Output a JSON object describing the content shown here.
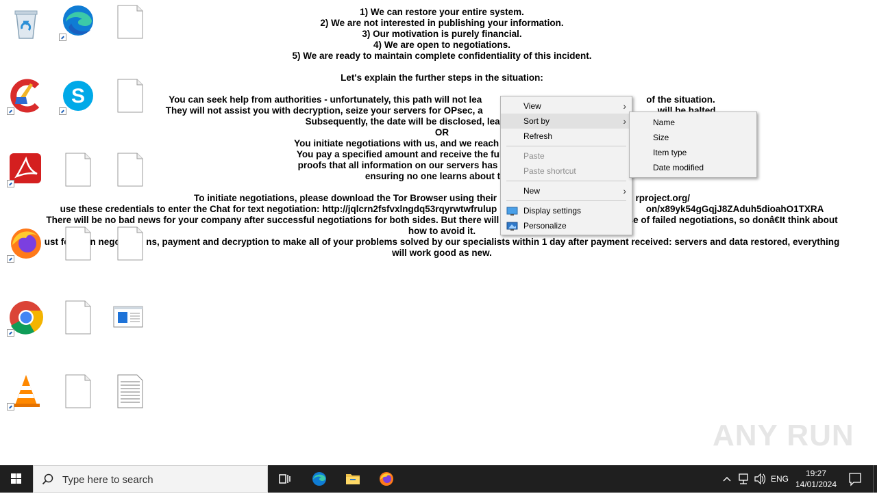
{
  "ransom_note": {
    "lines": [
      "1) We can restore your entire system.",
      "2) We are not interested in publishing your information.",
      "3) Our motivation is purely financial.",
      "4) We are open to negotiations.",
      "5) We are ready to maintain complete confidentiality of this incident.",
      "",
      "Let's explain the further steps in the situation:",
      "",
      "You can seek help from authorities - unfortunately, this path will not lea                                                                of the situation.",
      "They will not assist you with decryption, seize your servers for OPsec, a                                                                    will be halted.",
      "Subsequently, the date will be disclosed, leading to fines, lega",
      "OR",
      "You initiate negotiations with us, and we reach a mutually beneficia",
      "You pay a specified amount and receive the full decryption, suppo",
      "proofs that all information on our servers has been deleted, and a",
      "ensuring no one learns about this i",
      "",
      "To initiate negotiations, please download the Tor Browser using their                                                      rproject.org/",
      "use these credentials to enter the Chat for text negotiation: http://jqlcrn2fsfvxlngdq53rqyrwtwfrulup                                                          on/x89yk54gGqjJ8ZAduh5dioahO1TXRA",
      "There will be no bad news for your company after successful negotiations for both sides. But there will be                                             se of failed negotiations, so donâ€It think about",
      "how to avoid it.",
      "ust fo        n nego          ns, payment and decryption to make all of your problems solved by our specialists within 1 day after payment received: servers and data restored, everything",
      "will work good as new."
    ]
  },
  "desktop_icons": [
    {
      "name": "recycle-bin-icon",
      "shortcut": false
    },
    {
      "name": "edge-icon",
      "shortcut": true
    },
    {
      "name": "blank-file-icon",
      "shortcut": false
    },
    {
      "name": "ccleaner-icon",
      "shortcut": true
    },
    {
      "name": "skype-icon",
      "shortcut": true
    },
    {
      "name": "blank-file-icon",
      "shortcut": false
    },
    {
      "name": "acrobat-reader-icon",
      "shortcut": true
    },
    {
      "name": "blank-file-icon",
      "shortcut": false
    },
    {
      "name": "blank-file-icon",
      "shortcut": false
    },
    {
      "name": "firefox-icon",
      "shortcut": true
    },
    {
      "name": "blank-file-icon",
      "shortcut": false
    },
    {
      "name": "blank-file-icon",
      "shortcut": false
    },
    {
      "name": "chrome-icon",
      "shortcut": true
    },
    {
      "name": "blank-file-icon",
      "shortcut": false
    },
    {
      "name": "window-file-icon",
      "shortcut": false
    },
    {
      "name": "vlc-icon",
      "shortcut": true
    },
    {
      "name": "blank-file-icon",
      "shortcut": false
    },
    {
      "name": "text-document-icon",
      "shortcut": false
    }
  ],
  "context_menu": {
    "view": "View",
    "sort_by": "Sort by",
    "refresh": "Refresh",
    "paste": "Paste",
    "paste_shortcut": "Paste shortcut",
    "new": "New",
    "display_settings": "Display settings",
    "personalize": "Personalize",
    "submenu_arrow": "›"
  },
  "sort_submenu": {
    "name": "Name",
    "size": "Size",
    "item_type": "Item type",
    "date_modified": "Date modified"
  },
  "watermark": "ANY RUN",
  "taskbar": {
    "search_placeholder": "Type here to search",
    "language": "ENG",
    "time": "19:27",
    "date": "14/01/2024"
  },
  "colors": {
    "taskbar_bg": "#1f1f1f",
    "menu_bg": "#f2f2f2",
    "menu_highlight": "#e1e1e1",
    "disabled_text": "#8d8d8d"
  }
}
